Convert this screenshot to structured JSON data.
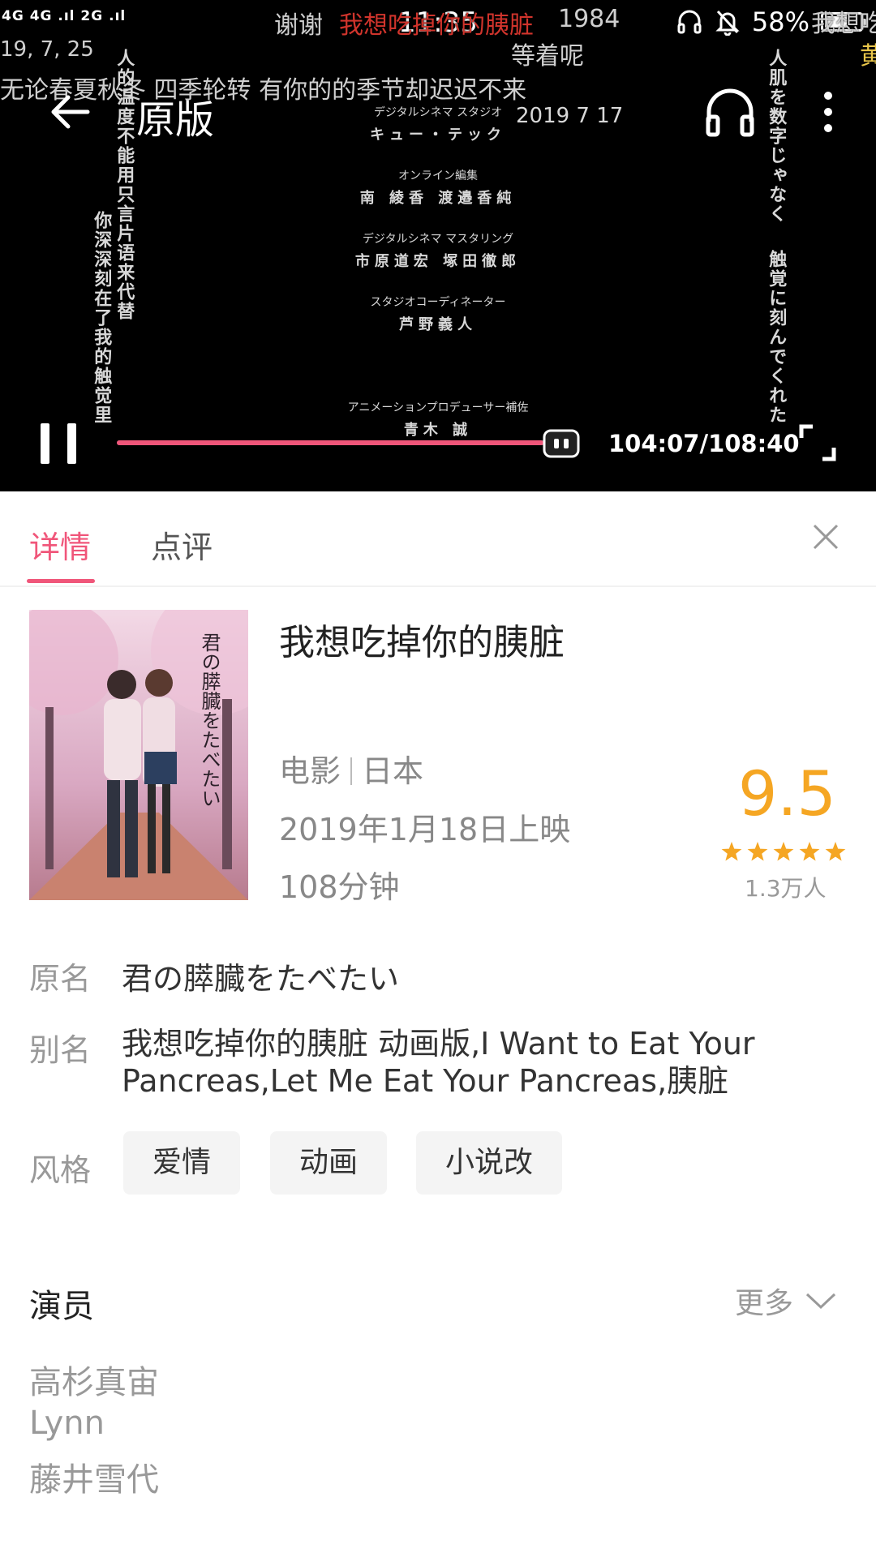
{
  "status_bar": {
    "network": "4G 4G .ıl 2G .ıl",
    "time": "11:35",
    "battery": "58%"
  },
  "player": {
    "title": "原版",
    "time_readout": "104:07/108:40",
    "progress_fraction": 0.959,
    "danmaku": {
      "top_a": "谢谢",
      "top_red": "我想吃掉你的胰脏",
      "top_b": "1984",
      "top_c": "等着呢",
      "left_date": "19, 7, 25",
      "line_main": "无论春夏秋冬  四季轮转  有你的的季节却迟迟不来",
      "right_top": "我想吃掉",
      "right_edge": "黄",
      "vertical_left_1": "人的温度不能用只言片语来代替",
      "vertical_left_2": "你深深刻在了我的触觉里",
      "vertical_right_1": "人肌を数字じゃなく",
      "vertical_right_2": "触覚に刻んでくれた"
    },
    "credits": {
      "studio_role": "デジタルシネマ スタジオ",
      "studio_name": "キュー・テック",
      "studio_date": "2019  7  17",
      "edit_role": "オンライン編集",
      "edit_names": "南  綾香   渡邉香純",
      "master_role": "デジタルシネマ マスタリング",
      "master_names": "市原道宏  塚田徹郎",
      "coord_role": "スタジオコーディネーター",
      "coord_name": "芦野義人",
      "anim_role": "アニメーションプロデューサー補佐",
      "anim_name": "青木  誠"
    }
  },
  "tabs": {
    "details": "详情",
    "reviews": "点评"
  },
  "movie": {
    "title": "我想吃掉你的胰脏",
    "type": "电影",
    "region": "日本",
    "release": "2019年1月18日上映",
    "duration": "108分钟",
    "rating": "9.5",
    "stars": 5,
    "votes": "1.3万人",
    "poster_text": "君の膵臓をたべたい"
  },
  "info": {
    "original_label": "原名",
    "original_value": "君の膵臓をたべたい",
    "alias_label": "别名",
    "alias_value": "我想吃掉你的胰脏   动画版,I Want to Eat Your Pancreas,Let Me Eat Your Pancreas,胰脏",
    "genre_label": "风格",
    "genres": [
      "爱情",
      "动画",
      "小说改"
    ]
  },
  "cast": {
    "title": "演员",
    "more": "更多",
    "actors": [
      "高杉真宙",
      "Lynn",
      "藤井雪代"
    ]
  },
  "colors": {
    "accent": "#f0567a",
    "rating": "#f5a623"
  }
}
